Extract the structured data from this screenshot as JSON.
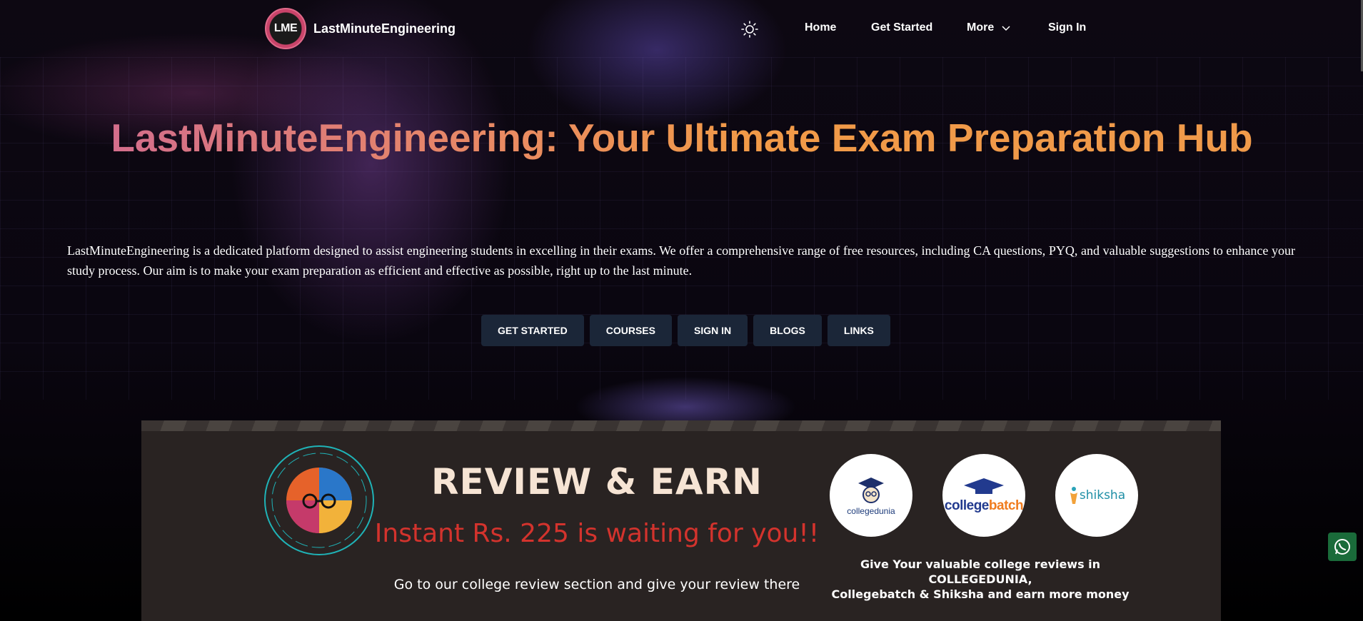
{
  "header": {
    "logo_text": "LME",
    "brand": "LastMinuteEngineering",
    "theme_icon": "sun-icon",
    "nav": {
      "home": "Home",
      "get_started": "Get Started",
      "more": "More",
      "sign_in": "Sign In"
    }
  },
  "hero": {
    "title": "LastMinuteEngineering: Your Ultimate Exam Preparation Hub",
    "description": "LastMinuteEngineering is a dedicated platform designed to assist engineering students in excelling in their exams. We offer a comprehensive range of free resources, including CA questions, PYQ, and valuable suggestions to enhance your study process. Our aim is to make your exam preparation as efficient and effective as possible, right up to the last minute.",
    "buttons": [
      "GET STARTED",
      "COURSES",
      "SIGN IN",
      "BLOGS",
      "LINKS"
    ]
  },
  "banner": {
    "title": "REVIEW & EARN",
    "subtitle": "Instant Rs. 225 is waiting for you!!",
    "cta_text": "Go to our college review section and give your review there",
    "partners": {
      "collegedunia": "collegedunia",
      "collegebatch_a": "college",
      "collegebatch_b": "batch",
      "shiksha": "shiksha"
    },
    "reviews_text_line1": "Give Your valuable college reviews in COLLEGEDUNIA,",
    "reviews_text_line2": "Collegebatch & Shiksha  and earn more money"
  },
  "colors": {
    "accent_pink": "#d16b90",
    "accent_orange": "#f19a48",
    "button_bg": "#1b2638",
    "banner_red": "#d3332d"
  }
}
